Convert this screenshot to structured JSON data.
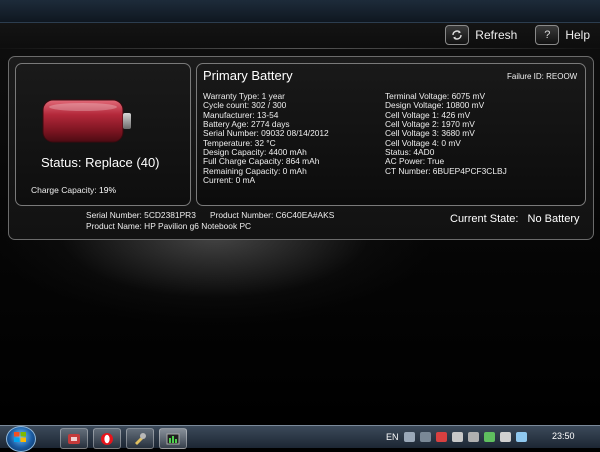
{
  "toolbar": {
    "refresh_label": "Refresh",
    "help_label": "Help"
  },
  "status": {
    "text": "Status: Replace (40)",
    "charge_capacity_label": "Charge Capacity:",
    "charge_capacity_value": "19%",
    "battery_color": "#b3283a"
  },
  "primary_battery": {
    "title": "Primary Battery",
    "failure_id": "Failure ID: REOOW",
    "left_column": [
      "Warranty Type: 1 year",
      "Cycle count: 302 / 300",
      "Manufacturer: 13-54",
      "Battery Age: 2774 days",
      "Serial Number: 09032 08/14/2012",
      "Temperature: 32 °C",
      "Design Capacity: 4400 mAh",
      "Full Charge Capacity: 864 mAh",
      "Remaining Capacity: 0 mAh",
      "Current: 0 mA"
    ],
    "right_column": [
      "Terminal Voltage: 6075 mV",
      "Design Voltage: 10800 mV",
      "Cell Voltage 1: 426 mV",
      "Cell Voltage 2: 1970 mV",
      "Cell Voltage 3: 3680 mV",
      "Cell Voltage 4: 0 mV",
      "Status: 4AD0",
      "AC Power: True",
      "CT Number: 6BUEP4PCF3CLBJ"
    ]
  },
  "system": {
    "serial_number": "Serial Number: 5CD2381PR3",
    "product_number": "Product Number: C6C40EA#AKS",
    "product_name": "Product Name: HP Pavilion g6 Notebook PC",
    "current_state_label": "Current State:",
    "current_state_value": "No Battery"
  },
  "taskbar": {
    "language": "EN",
    "clock": "23:50",
    "pinned": [
      "start-orb",
      "hp-support-icon",
      "opera-icon",
      "tools-icon",
      "battery-check-icon"
    ]
  }
}
